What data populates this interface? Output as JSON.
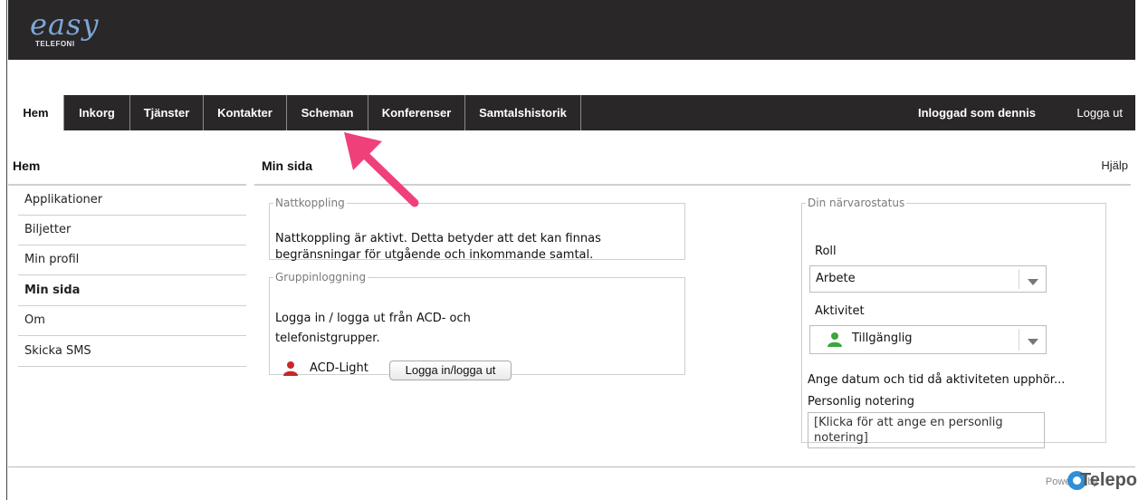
{
  "app": {
    "logo_text": "easy",
    "logo_sub": "TELEFONI"
  },
  "nav": {
    "tabs": [
      {
        "label": "Hem",
        "active": true
      },
      {
        "label": "Inkorg"
      },
      {
        "label": "Tjänster"
      },
      {
        "label": "Kontakter"
      },
      {
        "label": "Scheman"
      },
      {
        "label": "Konferenser"
      },
      {
        "label": "Samtalshistorik"
      }
    ],
    "logged_in": "Inloggad som dennis",
    "logout": "Logga ut"
  },
  "sidebar": {
    "title": "Hem",
    "items": [
      {
        "label": "Applikationer"
      },
      {
        "label": "Biljetter"
      },
      {
        "label": "Min profil"
      },
      {
        "label": "Min sida",
        "active": true
      },
      {
        "label": "Om"
      },
      {
        "label": "Skicka SMS"
      }
    ]
  },
  "main": {
    "title": "Min sida",
    "help": "Hjälp",
    "night": {
      "legend": "Nattkoppling",
      "text": "Nattkoppling är aktivt. Detta betyder att det kan finnas begränsningar för utgående och inkommande samtal."
    },
    "group": {
      "legend": "Gruppinloggning",
      "text": "Logga in / logga ut från ACD- och telefonistgrupper.",
      "acd_name": "ACD-Light",
      "button": "Logga in/logga ut",
      "icon": "person-icon-red"
    },
    "presence": {
      "legend": "Din närvarostatus",
      "role_label": "Roll",
      "role_value": "Arbete",
      "activity_label": "Aktivitet",
      "activity_value": "Tillgänglig",
      "activity_icon": "person-icon-green",
      "end_link": "Ange datum och tid då aktiviteten upphör...",
      "note_label": "Personlig notering",
      "note_value": "[Klicka för att ange en personlig notering]"
    }
  },
  "footer": {
    "powered_by": "Powered by",
    "brand": "Telepo"
  },
  "colors": {
    "header_bg": "#2a2728",
    "logo_blue": "#7ea7d8",
    "arrow_pink": "#f0407a",
    "user_red": "#c62828",
    "user_green": "#3ea53e"
  }
}
